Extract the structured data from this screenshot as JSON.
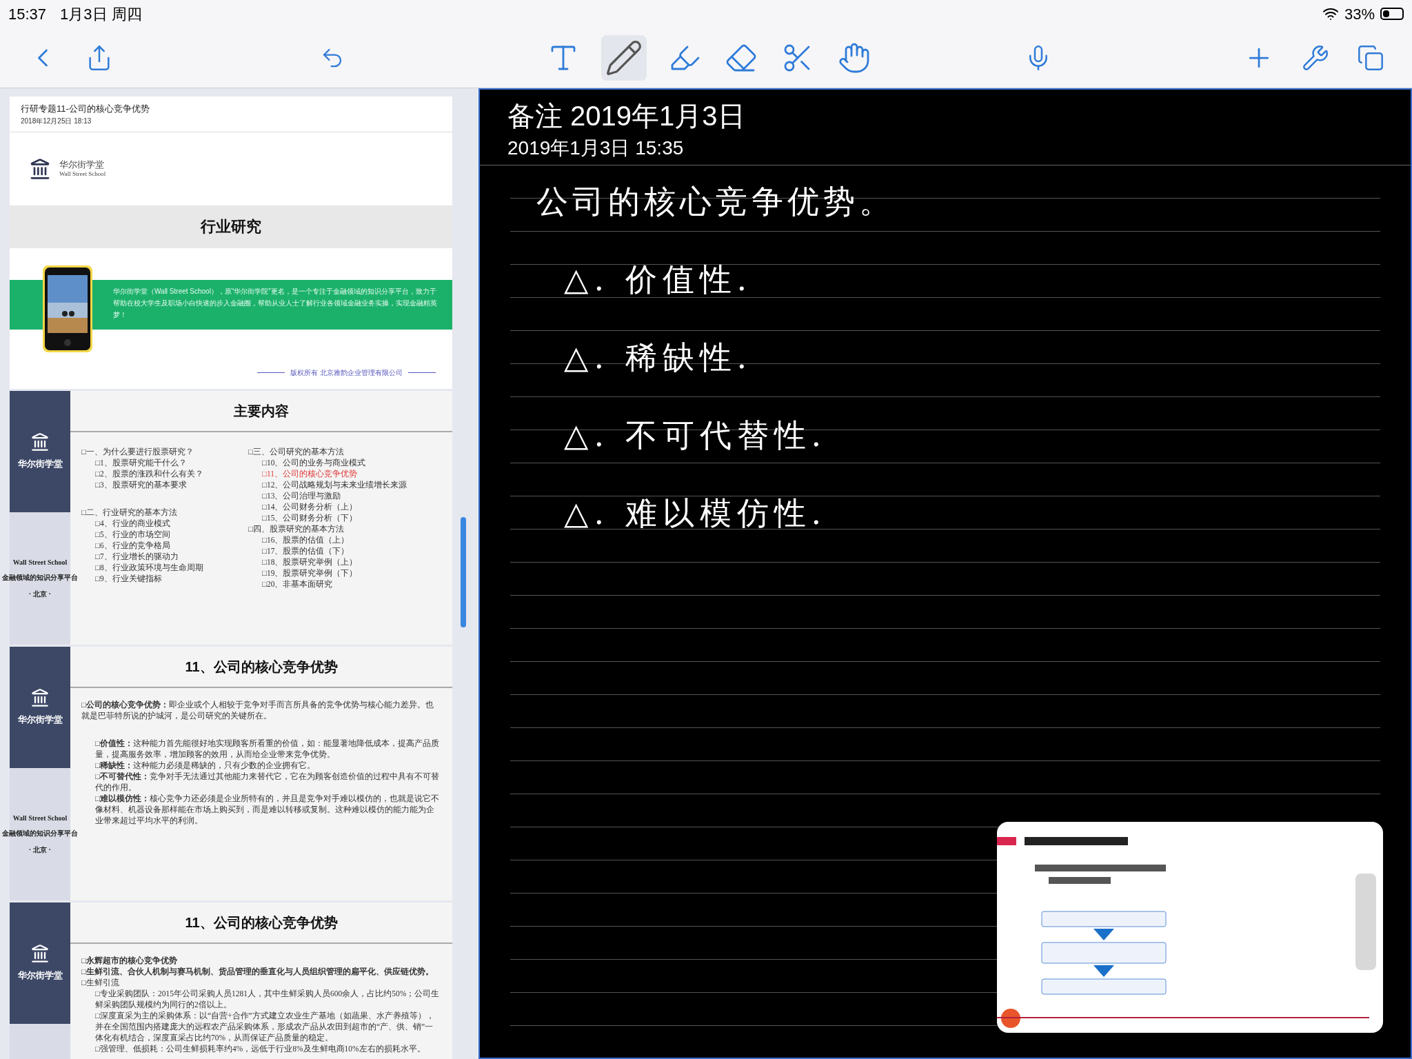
{
  "status_bar": {
    "time": "15:37",
    "date": "1月3日 周四",
    "battery": "33%"
  },
  "toolbar": {
    "tools": [
      {
        "kind": "text",
        "selected": false
      },
      {
        "kind": "pencil",
        "selected": true
      },
      {
        "kind": "highlighter",
        "selected": false
      },
      {
        "kind": "eraser",
        "selected": false
      },
      {
        "kind": "scissors",
        "selected": false
      },
      {
        "kind": "hand",
        "selected": false
      }
    ]
  },
  "document": {
    "title": "行研专题11-公司的核心竞争优势",
    "date": "2018年12月25日 18:13",
    "cover": {
      "logo_cn": "华尔街学堂",
      "logo_en": "Wall Street School",
      "heading": "行业研究",
      "intro": "华尔街学堂（Wall Street School），原“华尔街学院”更名，是一个专注于金融领域的知识分享平台，致力于帮助在校大学生及职场小白快速的步入金融圈，帮助从业人士了解行业各领域金融业务实操，实现金融精英梦！",
      "footer": "版权所有 北京雅韵企业管理有限公司"
    },
    "sidebars": [
      {
        "name": "华尔街学堂",
        "en": "Wall Street School",
        "tagline": "金融领域的知识分享平台",
        "city": "· 北京 ·"
      },
      {
        "name": "华尔街学堂",
        "en": "Wall Street School",
        "tagline": "金融领域的知识分享平台",
        "city": "· 北京 ·"
      },
      {
        "name": "华尔街学堂"
      }
    ],
    "contents": {
      "heading": "主要内容",
      "columns": [
        [
          {
            "text": "□一、为什么要进行股票研究？",
            "highlighted": false,
            "children": [
              {
                "text": "□1、股票研究能干什么？",
                "highlighted": false
              },
              {
                "text": "□2、股票的涨跌和什么有关？",
                "highlighted": false
              },
              {
                "text": "□3、股票研究的基本要求",
                "highlighted": false
              }
            ]
          },
          {
            "text": "□二、行业研究的基本方法",
            "highlighted": false,
            "children": [
              {
                "text": "□4、行业的商业模式",
                "highlighted": false
              },
              {
                "text": "□5、行业的市场空间",
                "highlighted": false
              },
              {
                "text": "□6、行业的竞争格局",
                "highlighted": false
              },
              {
                "text": "□7、行业增长的驱动力",
                "highlighted": false
              },
              {
                "text": "□8、行业政策环境与生命周期",
                "highlighted": false
              },
              {
                "text": "□9、行业关键指标",
                "highlighted": false
              }
            ]
          }
        ],
        [
          {
            "text": "□三、公司研究的基本方法",
            "highlighted": false,
            "children": [
              {
                "text": "□10、公司的业务与商业模式",
                "highlighted": false
              },
              {
                "text": "□11、公司的核心竞争优势",
                "highlighted": true
              },
              {
                "text": "□12、公司战略规划与未来业绩增长来源",
                "highlighted": false
              },
              {
                "text": "□13、公司治理与激励",
                "highlighted": false
              },
              {
                "text": "□14、公司财务分析（上）",
                "highlighted": false
              },
              {
                "text": "□15、公司财务分析（下）",
                "highlighted": false
              }
            ]
          },
          {
            "text": "□四、股票研究的基本方法",
            "highlighted": false,
            "children": [
              {
                "text": "□16、股票的估值（上）",
                "highlighted": false
              },
              {
                "text": "□17、股票的估值（下）",
                "highlighted": false
              },
              {
                "text": "□18、股票研究举例（上）",
                "highlighted": false
              },
              {
                "text": "□19、股票研究举例（下）",
                "highlighted": false
              },
              {
                "text": "□20、非基本面研究",
                "highlighted": false
              }
            ]
          }
        ]
      ]
    },
    "slides": [
      {
        "heading": "11、公司的核心竞争优势",
        "paragraphs": [
          {
            "text": "□**公司的核心竞争优势：**即企业或个人相较于竞争对手而言所具备的竞争优势与核心能力差异。也就是巴菲特所说的护城河，是公司研究的关键所在。",
            "indent": false,
            "gap": true
          },
          {
            "text": "□**价值性：**这种能力首先能很好地实现顾客所看重的价值，如：能显著地降低成本，提高产品质量，提高服务效率，增加顾客的效用，从而给企业带来竞争优势。",
            "indent": true,
            "gap": false
          },
          {
            "text": "□**稀缺性：**这种能力必须是稀缺的，只有少数的企业拥有它。",
            "indent": true,
            "gap": false
          },
          {
            "text": "□**不可替代性：**竞争对手无法通过其他能力来替代它，它在为顾客创造价值的过程中具有不可替代的作用。",
            "indent": true,
            "gap": false
          },
          {
            "text": "□**难以模仿性：**核心竞争力还必须是企业所特有的，并且是竞争对手难以模仿的，也就是说它不像材料、机器设备那样能在市场上购买到，而是难以转移或复制。这种难以模仿的能力能为企业带来超过平均水平的利润。",
            "indent": true,
            "gap": false
          }
        ]
      },
      {
        "heading": "11、公司的核心竞争优势",
        "paragraphs": [
          {
            "text": "**□永辉超市的核心竞争优势**",
            "indent": false,
            "gap": false
          },
          {
            "text": "**□生鲜引流、合伙人机制与赛马机制、货品管理的垂直化与人员组织管理的扁平化、供应链优势。**",
            "indent": false,
            "gap": false
          },
          {
            "text": "□生鲜引流",
            "indent": false,
            "gap": false
          },
          {
            "text": "□专业采购团队：2015年公司采购人员1281人，其中生鲜采购人员600余人，占比约50%；公司生鲜采购团队规模约为同行的2倍以上。",
            "indent": true,
            "gap": false
          },
          {
            "text": "□深度直采为主的采购体系：以“自营+合作”方式建立农业生产基地（如蔬果、水产养殖等），并在全国范围内搭建庞大的远程农产品采购体系，形成农产品从农田到超市的“产、供、销”一体化有机结合，深度直采占比约70%，从而保证产品质量的稳定。",
            "indent": true,
            "gap": false
          },
          {
            "text": "□强管理、低损耗：公司生鲜损耗率约4%，远低于行业8%及生鲜电商10%左右的损耗水平。",
            "indent": true,
            "gap": false
          }
        ]
      }
    ]
  },
  "note": {
    "title": "备注 2019年1月3日",
    "timestamp": "2019年1月3日 15:35",
    "heading": "公司的核心竞争优势。",
    "items": [
      "△. 价值性.",
      "△. 稀缺性.",
      "△. 不可代替性.",
      "△. 难以模仿性."
    ]
  }
}
